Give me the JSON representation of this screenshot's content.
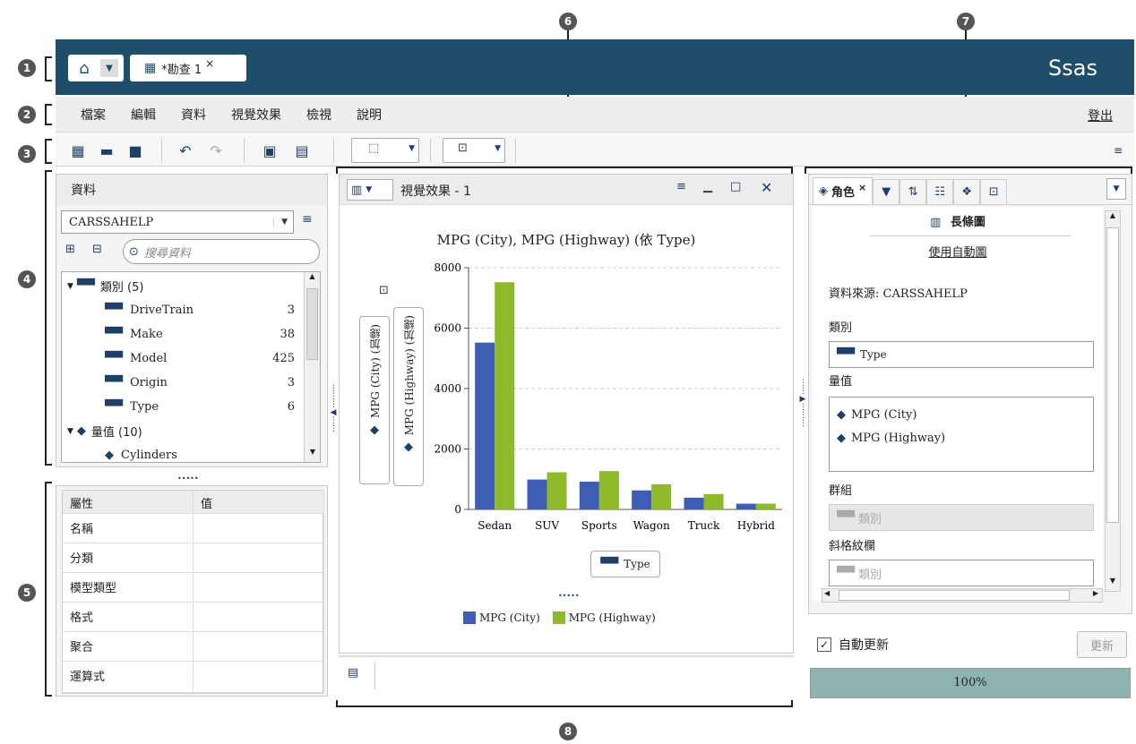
{
  "callouts": [
    "1",
    "2",
    "3",
    "4",
    "5",
    "6",
    "7",
    "8"
  ],
  "tabs": {
    "doc": "*勘查 1",
    "close": "×"
  },
  "logo": "Ssas",
  "menu": [
    "檔案",
    "編輯",
    "資料",
    "視覺效果",
    "檢視",
    "說明"
  ],
  "logout": "登出",
  "data_panel": {
    "title": "資料",
    "source": "CARSSAHELP",
    "search_placeholder": "搜尋資料",
    "category_group": "類別 (5)",
    "items": [
      {
        "name": "DriveTrain",
        "count": "3"
      },
      {
        "name": "Make",
        "count": "38"
      },
      {
        "name": "Model",
        "count": "425"
      },
      {
        "name": "Origin",
        "count": "3"
      },
      {
        "name": "Type",
        "count": "6"
      }
    ],
    "measure_group": "量值 (10)",
    "measure_first": "Cylinders"
  },
  "props": {
    "col1": "屬性",
    "col2": "值",
    "rows": [
      "名稱",
      "分類",
      "模型類型",
      "格式",
      "聚合",
      "運算式"
    ]
  },
  "viz": {
    "title": "視覺效果 - 1",
    "chart_title": "MPG (City), MPG (Highway) (依 Type)",
    "yaxis1": "MPG (City) (加總)",
    "yaxis2": "MPG (Highway) (加總)",
    "xaxis_button": "Type",
    "more": "•••••"
  },
  "chart_data": {
    "type": "bar",
    "title": "MPG (City), MPG (Highway) (依 Type)",
    "categories": [
      "Sedan",
      "SUV",
      "Sports",
      "Wagon",
      "Truck",
      "Hybrid"
    ],
    "series": [
      {
        "name": "MPG (City)",
        "values": [
          5520,
          990,
          920,
          630,
          390,
          190
        ],
        "color": "#3e5eb6"
      },
      {
        "name": "MPG (Highway)",
        "values": [
          7520,
          1230,
          1270,
          830,
          510,
          190
        ],
        "color": "#8db92b"
      }
    ],
    "yticks": [
      "0",
      "2000",
      "4000",
      "6000",
      "8000"
    ],
    "ylim": [
      0,
      8000
    ],
    "grid": true,
    "legend": "bottom"
  },
  "roles": {
    "tab": "角色",
    "chart_type": "長條圖",
    "auto_chart": "使用自動圖",
    "source_label": "資料來源: CARSSAHELP",
    "category_label": "類別",
    "category_value": "Type",
    "measure_label": "量值",
    "measures": [
      "MPG (City)",
      "MPG (Highway)"
    ],
    "group_label": "群組",
    "group_placeholder": "類別",
    "lattice_label": "斜格紋欄",
    "lattice_placeholder": "類別"
  },
  "auto_update": "自動更新",
  "update_btn": "更新",
  "progress": "100%",
  "progress_value": 1.0,
  "colors": {
    "topbar": "#1f4e6b",
    "city": "#3e5eb6",
    "highway": "#8db92b",
    "progress": "#8fb3b3"
  }
}
